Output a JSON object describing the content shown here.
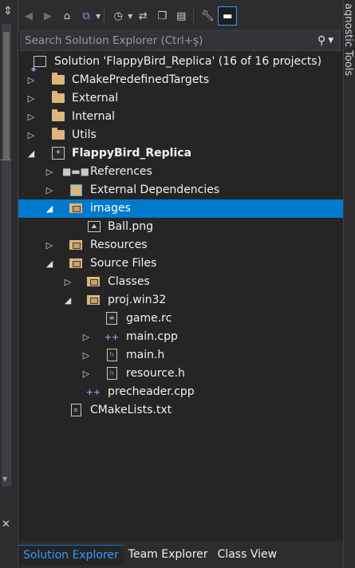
{
  "window": {
    "left_pin_glyph": "⇕",
    "left_close_glyph": "✕",
    "right_vertical_label": "agnostic Tools"
  },
  "toolbar": {
    "icons": [
      "back-icon",
      "forward-icon",
      "home-icon",
      "vs-switch-view-icon",
      "history-icon",
      "sync-icon",
      "collapse-all-icon",
      "show-all-files-icon",
      "properties-icon",
      "preview-icon"
    ]
  },
  "search": {
    "placeholder": "Search Solution Explorer (Ctrl+ş)"
  },
  "tree": {
    "solution": "Solution 'FlappyBird_Replica' (16 of 16 projects)",
    "items": [
      {
        "label": "CMakePredefinedTargets",
        "icon": "folder-icon"
      },
      {
        "label": "External",
        "icon": "folder-icon"
      },
      {
        "label": "Internal",
        "icon": "folder-icon"
      },
      {
        "label": "Utils",
        "icon": "folder-icon"
      },
      {
        "label": "FlappyBird_Replica",
        "icon": "cpp-project-icon"
      },
      {
        "label": "References",
        "icon": "references-icon"
      },
      {
        "label": "External Dependencies",
        "icon": "external-deps-icon"
      },
      {
        "label": "images",
        "icon": "filter-folder-icon"
      },
      {
        "label": "Ball.png",
        "icon": "image-file-icon"
      },
      {
        "label": "Resources",
        "icon": "filter-folder-icon"
      },
      {
        "label": "Source Files",
        "icon": "filter-folder-icon"
      },
      {
        "label": "Classes",
        "icon": "filter-folder-icon"
      },
      {
        "label": "proj.win32",
        "icon": "filter-folder-icon"
      },
      {
        "label": "game.rc",
        "icon": "rc-file-icon"
      },
      {
        "label": "main.cpp",
        "icon": "cpp-file-icon"
      },
      {
        "label": "main.h",
        "icon": "header-file-icon"
      },
      {
        "label": "resource.h",
        "icon": "header-file-icon"
      },
      {
        "label": "precheader.cpp",
        "icon": "cpp-file-icon"
      },
      {
        "label": "CMakeLists.txt",
        "icon": "text-file-icon"
      }
    ]
  },
  "tabs": [
    {
      "label": "Solution Explorer",
      "active": true
    },
    {
      "label": "Team Explorer",
      "active": false
    },
    {
      "label": "Class View",
      "active": false
    }
  ],
  "colors": {
    "background": "#252526",
    "chrome": "#2d2d30",
    "selection": "#007acc",
    "accent": "#3399ff",
    "folder": "#dcb67a",
    "cpp": "#b180d7"
  }
}
